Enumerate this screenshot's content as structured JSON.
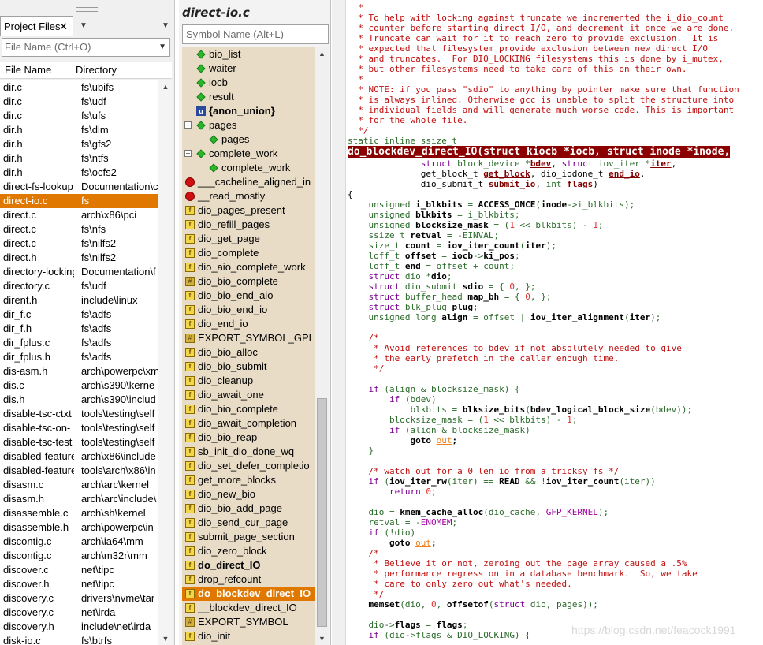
{
  "project_files": {
    "tab_label": "Project Files",
    "tab_close": "✕",
    "filter_placeholder": "File Name (Ctrl+O)",
    "columns": [
      "File Name",
      "Directory"
    ],
    "rows": [
      {
        "file": "dir.c",
        "dir": "fs\\ubifs"
      },
      {
        "file": "dir.c",
        "dir": "fs\\udf"
      },
      {
        "file": "dir.c",
        "dir": "fs\\ufs"
      },
      {
        "file": "dir.h",
        "dir": "fs\\dlm"
      },
      {
        "file": "dir.h",
        "dir": "fs\\gfs2"
      },
      {
        "file": "dir.h",
        "dir": "fs\\ntfs"
      },
      {
        "file": "dir.h",
        "dir": "fs\\ocfs2"
      },
      {
        "file": "direct-fs-lookup",
        "dir": "Documentation\\cr"
      },
      {
        "file": "direct-io.c",
        "dir": "fs",
        "selected": true
      },
      {
        "file": "direct.c",
        "dir": "arch\\x86\\pci"
      },
      {
        "file": "direct.c",
        "dir": "fs\\nfs"
      },
      {
        "file": "direct.c",
        "dir": "fs\\nilfs2"
      },
      {
        "file": "direct.h",
        "dir": "fs\\nilfs2"
      },
      {
        "file": "directory-locking",
        "dir": "Documentation\\f"
      },
      {
        "file": "directory.c",
        "dir": "fs\\udf"
      },
      {
        "file": "dirent.h",
        "dir": "include\\linux"
      },
      {
        "file": "dir_f.c",
        "dir": "fs\\adfs"
      },
      {
        "file": "dir_f.h",
        "dir": "fs\\adfs"
      },
      {
        "file": "dir_fplus.c",
        "dir": "fs\\adfs"
      },
      {
        "file": "dir_fplus.h",
        "dir": "fs\\adfs"
      },
      {
        "file": "dis-asm.h",
        "dir": "arch\\powerpc\\xm"
      },
      {
        "file": "dis.c",
        "dir": "arch\\s390\\kerne"
      },
      {
        "file": "dis.h",
        "dir": "arch\\s390\\includ"
      },
      {
        "file": "disable-tsc-ctxt",
        "dir": "tools\\testing\\self"
      },
      {
        "file": "disable-tsc-on-",
        "dir": "tools\\testing\\self"
      },
      {
        "file": "disable-tsc-test",
        "dir": "tools\\testing\\self"
      },
      {
        "file": "disabled-feature",
        "dir": "arch\\x86\\include"
      },
      {
        "file": "disabled-feature",
        "dir": "tools\\arch\\x86\\in"
      },
      {
        "file": "disasm.c",
        "dir": "arch\\arc\\kernel"
      },
      {
        "file": "disasm.h",
        "dir": "arch\\arc\\include\\"
      },
      {
        "file": "disassemble.c",
        "dir": "arch\\sh\\kernel"
      },
      {
        "file": "disassemble.h",
        "dir": "arch\\powerpc\\in"
      },
      {
        "file": "discontig.c",
        "dir": "arch\\ia64\\mm"
      },
      {
        "file": "discontig.c",
        "dir": "arch\\m32r\\mm"
      },
      {
        "file": "discover.c",
        "dir": "net\\tipc"
      },
      {
        "file": "discover.h",
        "dir": "net\\tipc"
      },
      {
        "file": "discovery.c",
        "dir": "drivers\\nvme\\tar"
      },
      {
        "file": "discovery.c",
        "dir": "net\\irda"
      },
      {
        "file": "discovery.h",
        "dir": "include\\net\\irda"
      },
      {
        "file": "disk-io.c",
        "dir": "fs\\btrfs"
      }
    ]
  },
  "symbols": {
    "title": "direct-io.c",
    "filter_placeholder": "Symbol Name (Alt+L)",
    "rows": [
      {
        "label": "bio_list",
        "icon": "member-diamond-icon",
        "indent": 1
      },
      {
        "label": "waiter",
        "icon": "member-diamond-icon",
        "indent": 1
      },
      {
        "label": "iocb",
        "icon": "member-diamond-icon",
        "indent": 1
      },
      {
        "label": "result",
        "icon": "member-diamond-icon",
        "indent": 1
      },
      {
        "label": "{anon_union}",
        "icon": "union-icon",
        "indent": 1,
        "bold": true
      },
      {
        "label": "pages",
        "icon": "member-diamond-icon",
        "indent": 1,
        "toggle": "−"
      },
      {
        "label": "pages",
        "icon": "member-diamond-icon",
        "indent": 2
      },
      {
        "label": "complete_work",
        "icon": "member-diamond-icon",
        "indent": 1,
        "toggle": "−"
      },
      {
        "label": "complete_work",
        "icon": "member-diamond-icon",
        "indent": 2
      },
      {
        "label": "___cacheline_aligned_in",
        "icon": "red-ball-icon",
        "indent": 0
      },
      {
        "label": "__read_mostly",
        "icon": "red-ball-icon",
        "indent": 0
      },
      {
        "label": "dio_pages_present",
        "icon": "function-icon",
        "indent": 0
      },
      {
        "label": "dio_refill_pages",
        "icon": "function-icon",
        "indent": 0
      },
      {
        "label": "dio_get_page",
        "icon": "function-icon",
        "indent": 0
      },
      {
        "label": "dio_complete",
        "icon": "function-icon",
        "indent": 0
      },
      {
        "label": "dio_aio_complete_work",
        "icon": "function-icon",
        "indent": 0
      },
      {
        "label": "dio_bio_complete",
        "icon": "macro-icon",
        "indent": 0
      },
      {
        "label": "dio_bio_end_aio",
        "icon": "function-icon",
        "indent": 0
      },
      {
        "label": "dio_bio_end_io",
        "icon": "function-icon",
        "indent": 0
      },
      {
        "label": "dio_end_io",
        "icon": "function-icon",
        "indent": 0
      },
      {
        "label": "EXPORT_SYMBOL_GPL",
        "icon": "macro-icon",
        "indent": 0
      },
      {
        "label": "dio_bio_alloc",
        "icon": "function-icon",
        "indent": 0
      },
      {
        "label": "dio_bio_submit",
        "icon": "function-icon",
        "indent": 0
      },
      {
        "label": "dio_cleanup",
        "icon": "function-icon",
        "indent": 0
      },
      {
        "label": "dio_await_one",
        "icon": "function-icon",
        "indent": 0
      },
      {
        "label": "dio_bio_complete",
        "icon": "function-icon",
        "indent": 0
      },
      {
        "label": "dio_await_completion",
        "icon": "function-icon",
        "indent": 0
      },
      {
        "label": "dio_bio_reap",
        "icon": "function-icon",
        "indent": 0
      },
      {
        "label": "sb_init_dio_done_wq",
        "icon": "function-icon",
        "indent": 0
      },
      {
        "label": "dio_set_defer_completio",
        "icon": "function-icon",
        "indent": 0
      },
      {
        "label": "get_more_blocks",
        "icon": "function-icon",
        "indent": 0
      },
      {
        "label": "dio_new_bio",
        "icon": "function-icon",
        "indent": 0
      },
      {
        "label": "dio_bio_add_page",
        "icon": "function-icon",
        "indent": 0
      },
      {
        "label": "dio_send_cur_page",
        "icon": "function-icon",
        "indent": 0
      },
      {
        "label": "submit_page_section",
        "icon": "function-icon",
        "indent": 0
      },
      {
        "label": "dio_zero_block",
        "icon": "function-icon",
        "indent": 0
      },
      {
        "label": "do_direct_IO",
        "icon": "function-icon",
        "indent": 0,
        "bold": true
      },
      {
        "label": "drop_refcount",
        "icon": "function-icon",
        "indent": 0
      },
      {
        "label": "do_blockdev_direct_IO",
        "icon": "function-icon",
        "indent": 0,
        "bold": true,
        "selected": true
      },
      {
        "label": "__blockdev_direct_IO",
        "icon": "function-icon",
        "indent": 0
      },
      {
        "label": "EXPORT_SYMBOL",
        "icon": "macro-icon",
        "indent": 0
      },
      {
        "label": "dio_init",
        "icon": "function-icon",
        "indent": 0
      }
    ]
  },
  "code_lines": [
    [
      [
        "cm",
        "  *"
      ]
    ],
    [
      [
        "cm",
        "  * To help with locking against truncate we incremented the i_dio_count"
      ]
    ],
    [
      [
        "cm",
        "  * counter before starting direct I/O, and decrement it once we are done."
      ]
    ],
    [
      [
        "cm",
        "  * Truncate can wait for it to reach zero to provide exclusion.  It is"
      ]
    ],
    [
      [
        "cm",
        "  * expected that filesystem provide exclusion between new direct I/O"
      ]
    ],
    [
      [
        "cm",
        "  * and truncates.  For DIO_LOCKING filesystems this is done by i_mutex,"
      ]
    ],
    [
      [
        "cm",
        "  * but other filesystems need to take care of this on their own."
      ]
    ],
    [
      [
        "cm",
        "  *"
      ]
    ],
    [
      [
        "cm",
        "  * NOTE: if you pass \"sdio\" to anything by pointer make sure that function"
      ]
    ],
    [
      [
        "cm",
        "  * is always inlined. Otherwise gcc is unable to split the structure into"
      ]
    ],
    [
      [
        "cm",
        "  * individual fields and will generate much worse code. This is important"
      ]
    ],
    [
      [
        "cm",
        "  * for the whole file."
      ]
    ],
    [
      [
        "cm",
        "  */"
      ]
    ],
    [
      [
        "ty",
        "static inline ssize_t"
      ]
    ],
    [
      [
        "def",
        "do_blockdev_direct_IO"
      ],
      [
        "def",
        "(struct kiocb *"
      ],
      [
        "def",
        "iocb"
      ],
      [
        "def",
        ", struct inode *"
      ],
      [
        "def",
        "inode"
      ],
      [
        "def",
        ","
      ]
    ],
    [
      [
        "",
        "              "
      ],
      [
        "kw",
        "struct"
      ],
      [
        "ty",
        " block_device *"
      ],
      [
        "pm",
        "bdev"
      ],
      [
        "",
        ", "
      ],
      [
        "kw",
        "struct"
      ],
      [
        "ty",
        " iov_iter *"
      ],
      [
        "pm",
        "iter"
      ],
      [
        "",
        ","
      ]
    ],
    [
      [
        "",
        "              get_block_t "
      ],
      [
        "pm",
        "get_block"
      ],
      [
        "",
        ", dio_iodone_t "
      ],
      [
        "pm",
        "end_io"
      ],
      [
        "",
        ","
      ]
    ],
    [
      [
        "",
        "              dio_submit_t "
      ],
      [
        "pm",
        "submit_io"
      ],
      [
        "",
        ", "
      ],
      [
        "ty",
        "int"
      ],
      [
        "",
        " "
      ],
      [
        "pm",
        "flags"
      ],
      [
        "",
        ")"
      ]
    ],
    [
      [
        "",
        "{"
      ]
    ],
    [
      [
        "ty",
        "    unsigned "
      ],
      [
        "k",
        "i_blkbits"
      ],
      [
        "ty",
        " = "
      ],
      [
        "k",
        "ACCESS_ONCE"
      ],
      [
        "ty",
        "("
      ],
      [
        "k",
        "inode"
      ],
      [
        "ty",
        "->i_blkbits);"
      ]
    ],
    [
      [
        "ty",
        "    unsigned "
      ],
      [
        "k",
        "blkbits"
      ],
      [
        "ty",
        " = i_blkbits;"
      ]
    ],
    [
      [
        "ty",
        "    unsigned "
      ],
      [
        "k",
        "blocksize_mask"
      ],
      [
        "ty",
        " = ("
      ],
      [
        "num",
        "1"
      ],
      [
        "ty",
        " << blkbits) - "
      ],
      [
        "num",
        "1"
      ],
      [
        "ty",
        ";"
      ]
    ],
    [
      [
        "ty",
        "    ssize_t "
      ],
      [
        "k",
        "retval"
      ],
      [
        "ty",
        " = -EINVAL;"
      ]
    ],
    [
      [
        "ty",
        "    size_t "
      ],
      [
        "k",
        "count"
      ],
      [
        "ty",
        " = "
      ],
      [
        "k",
        "iov_iter_count"
      ],
      [
        "ty",
        "("
      ],
      [
        "k",
        "iter"
      ],
      [
        "ty",
        ");"
      ]
    ],
    [
      [
        "ty",
        "    loff_t "
      ],
      [
        "k",
        "offset"
      ],
      [
        "ty",
        " = "
      ],
      [
        "k",
        "iocb"
      ],
      [
        "ty",
        "->"
      ],
      [
        "k",
        "ki_pos"
      ],
      [
        "ty",
        ";"
      ]
    ],
    [
      [
        "ty",
        "    loff_t "
      ],
      [
        "k",
        "end"
      ],
      [
        "ty",
        " = offset + count;"
      ]
    ],
    [
      [
        "kw",
        "    struct"
      ],
      [
        "ty",
        " dio *"
      ],
      [
        "k",
        "dio"
      ],
      [
        "ty",
        ";"
      ]
    ],
    [
      [
        "kw",
        "    struct"
      ],
      [
        "ty",
        " dio_submit "
      ],
      [
        "k",
        "sdio"
      ],
      [
        "ty",
        " = { "
      ],
      [
        "num",
        "0"
      ],
      [
        "ty",
        ", };"
      ]
    ],
    [
      [
        "kw",
        "    struct"
      ],
      [
        "ty",
        " buffer_head "
      ],
      [
        "k",
        "map_bh"
      ],
      [
        "ty",
        " = { "
      ],
      [
        "num",
        "0"
      ],
      [
        "ty",
        ", };"
      ]
    ],
    [
      [
        "kw",
        "    struct"
      ],
      [
        "ty",
        " blk_plug "
      ],
      [
        "k",
        "plug"
      ],
      [
        "ty",
        ";"
      ]
    ],
    [
      [
        "ty",
        "    unsigned long "
      ],
      [
        "k",
        "align"
      ],
      [
        "ty",
        " = offset | "
      ],
      [
        "k",
        "iov_iter_alignment"
      ],
      [
        "ty",
        "("
      ],
      [
        "k",
        "iter"
      ],
      [
        "ty",
        ");"
      ]
    ],
    [
      [
        "",
        ""
      ]
    ],
    [
      [
        "cm",
        "    /*"
      ]
    ],
    [
      [
        "cm",
        "     * Avoid references to bdev if not absolutely needed to give"
      ]
    ],
    [
      [
        "cm",
        "     * the early prefetch in the caller enough time."
      ]
    ],
    [
      [
        "cm",
        "     */"
      ]
    ],
    [
      [
        "",
        ""
      ]
    ],
    [
      [
        "kw",
        "    if"
      ],
      [
        "ty",
        " (align & blocksize_mask) {"
      ]
    ],
    [
      [
        "kw",
        "        if"
      ],
      [
        "ty",
        " (bdev)"
      ]
    ],
    [
      [
        "ty",
        "            blkbits = "
      ],
      [
        "k",
        "blksize_bits"
      ],
      [
        "ty",
        "("
      ],
      [
        "k",
        "bdev_logical_block_size"
      ],
      [
        "ty",
        "(bdev));"
      ]
    ],
    [
      [
        "ty",
        "        blocksize_mask = ("
      ],
      [
        "num",
        "1"
      ],
      [
        "ty",
        " << blkbits) - "
      ],
      [
        "num",
        "1"
      ],
      [
        "ty",
        ";"
      ]
    ],
    [
      [
        "kw",
        "        if"
      ],
      [
        "ty",
        " (align & blocksize_mask)"
      ]
    ],
    [
      [
        "k",
        "            goto "
      ],
      [
        "lb",
        "out"
      ],
      [
        "k",
        ";"
      ]
    ],
    [
      [
        "ty",
        "    }"
      ]
    ],
    [
      [
        "",
        ""
      ]
    ],
    [
      [
        "cm",
        "    /* watch out for a 0 len io from a tricksy fs */"
      ]
    ],
    [
      [
        "kw",
        "    if"
      ],
      [
        "ty",
        " ("
      ],
      [
        "k",
        "iov_iter_rw"
      ],
      [
        "ty",
        "(iter) == "
      ],
      [
        "k",
        "READ"
      ],
      [
        "ty",
        " && !"
      ],
      [
        "k",
        "iov_iter_count"
      ],
      [
        "ty",
        "(iter))"
      ]
    ],
    [
      [
        "kw",
        "        return"
      ],
      [
        "ty",
        " "
      ],
      [
        "num",
        "0"
      ],
      [
        "ty",
        ";"
      ]
    ],
    [
      [
        "",
        ""
      ]
    ],
    [
      [
        "ty",
        "    dio = "
      ],
      [
        "k",
        "kmem_cache_alloc"
      ],
      [
        "ty",
        "(dio_cache, "
      ],
      [
        "mac",
        "GFP_KERNEL"
      ],
      [
        "ty",
        ");"
      ]
    ],
    [
      [
        "ty",
        "    retval = -"
      ],
      [
        "mac",
        "ENOMEM"
      ],
      [
        "ty",
        ";"
      ]
    ],
    [
      [
        "kw",
        "    if"
      ],
      [
        "ty",
        " (!dio)"
      ]
    ],
    [
      [
        "k",
        "        goto "
      ],
      [
        "lb",
        "out"
      ],
      [
        "k",
        ";"
      ]
    ],
    [
      [
        "cm",
        "    /*"
      ]
    ],
    [
      [
        "cm",
        "     * Believe it or not, zeroing out the page array caused a .5%"
      ]
    ],
    [
      [
        "cm",
        "     * performance regression in a database benchmark.  So, we take"
      ]
    ],
    [
      [
        "cm",
        "     * care to only zero out what's needed."
      ]
    ],
    [
      [
        "cm",
        "     */"
      ]
    ],
    [
      [
        "k",
        "    memset"
      ],
      [
        "ty",
        "(dio, "
      ],
      [
        "num",
        "0"
      ],
      [
        "ty",
        ", "
      ],
      [
        "k",
        "offsetof"
      ],
      [
        "ty",
        "("
      ],
      [
        "kw",
        "struct"
      ],
      [
        "ty",
        " dio, pages));"
      ]
    ],
    [
      [
        "",
        ""
      ]
    ],
    [
      [
        "ty",
        "    dio->"
      ],
      [
        "k",
        "flags"
      ],
      [
        "ty",
        " = "
      ],
      [
        "k",
        "flags"
      ],
      [
        "ty",
        ";"
      ]
    ],
    [
      [
        "kw",
        "    if"
      ],
      [
        "ty",
        " (dio->flags & DIO_LOCKING) {"
      ]
    ]
  ],
  "watermark": "https://blog.csdn.net/feacock1991",
  "colors": {
    "selection": "#e07800",
    "symbol_panel_bg": "#e8dcc6",
    "definition_bg": "#8b0000"
  }
}
